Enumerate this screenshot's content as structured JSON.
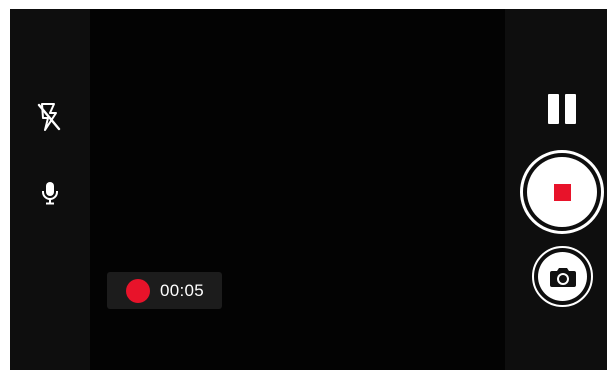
{
  "recording": {
    "time": "00:05",
    "indicator_color": "#e8132a"
  },
  "controls": {
    "left": [
      {
        "name": "flash-off",
        "icon": "flash-off-icon"
      },
      {
        "name": "microphone",
        "icon": "microphone-icon"
      }
    ],
    "right": [
      {
        "name": "pause",
        "icon": "pause-icon"
      },
      {
        "name": "stop-record",
        "icon": "stop-icon"
      },
      {
        "name": "snapshot",
        "icon": "camera-icon"
      }
    ]
  },
  "colors": {
    "background": "#050505",
    "side_bar": "#0e0e0e",
    "accent_red": "#e8132a",
    "button_white": "#ffffff"
  }
}
